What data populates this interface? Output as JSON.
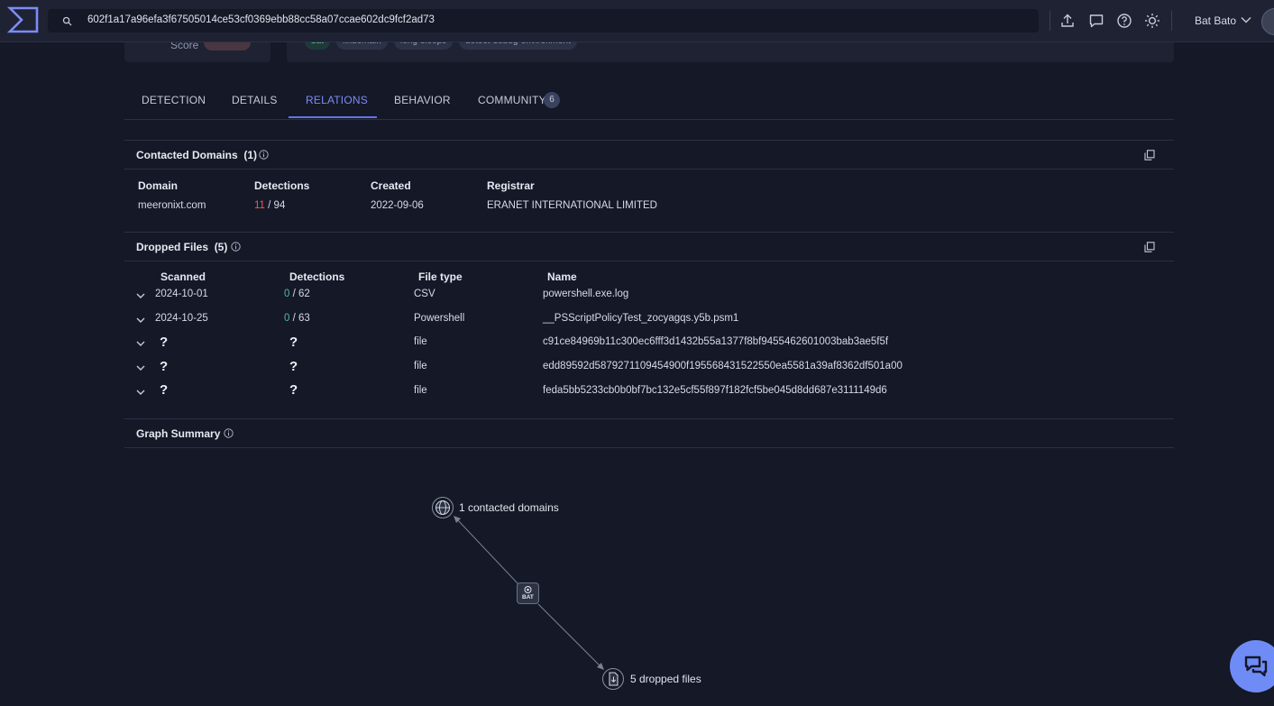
{
  "topbar": {
    "search_value": "602f1a17a96efa3f67505014ce53cf0369ebb88cc58a07ccae602dc9fcf2ad73",
    "user_name": "Bat Bato",
    "icons": [
      "upload-icon",
      "chat-icon",
      "help-icon",
      "theme-icon"
    ]
  },
  "header": {
    "score_label": "Score",
    "tags": [
      "bat",
      "fixdomain",
      "long-sleeps",
      "detect-debug-environment"
    ]
  },
  "tabs": [
    {
      "label": "DETECTION",
      "active": false
    },
    {
      "label": "DETAILS",
      "active": false
    },
    {
      "label": "RELATIONS",
      "active": true
    },
    {
      "label": "BEHAVIOR",
      "active": false
    },
    {
      "label": "COMMUNITY",
      "active": false,
      "badge": "6"
    }
  ],
  "contacted_domains": {
    "title": "Contacted Domains",
    "count": "(1)",
    "columns": [
      "Domain",
      "Detections",
      "Created",
      "Registrar"
    ],
    "rows": [
      {
        "domain": "meeronixt.com",
        "detections": "11",
        "total": "/ 94",
        "created": "2022-09-06",
        "registrar": "ERANET INTERNATIONAL LIMITED"
      }
    ]
  },
  "dropped_files": {
    "title": "Dropped Files",
    "count": "(5)",
    "columns": [
      "Scanned",
      "Detections",
      "File type",
      "Name"
    ],
    "rows": [
      {
        "scanned": "2024-10-01",
        "detections": "0",
        "total": "/ 62",
        "type": "CSV",
        "name": "powershell.exe.log"
      },
      {
        "scanned": "2024-10-25",
        "detections": "0",
        "total": "/ 63",
        "type": "Powershell",
        "name": "__PSScriptPolicyTest_zocyagqs.y5b.psm1"
      },
      {
        "scanned": "?",
        "detections": "?",
        "total": "",
        "type": "file",
        "name": "c91ce84969b11c300ec6fff3d1432b55a1377f8bf9455462601003bab3ae5f5f"
      },
      {
        "scanned": "?",
        "detections": "?",
        "total": "",
        "type": "file",
        "name": "edd89592d5879271109454900f195568431522550ea5581a39af8362df501a00"
      },
      {
        "scanned": "?",
        "detections": "?",
        "total": "",
        "type": "file",
        "name": "feda5bb5233cb0b0bf7bc132e5cf55f897f182fcf5be045d8dd687e3111149d6"
      }
    ]
  },
  "graph_summary": {
    "title": "Graph Summary",
    "center_node_label": "BAT",
    "domains_label": "1 contacted domains",
    "files_label": "5 dropped files"
  },
  "colors": {
    "accent": "#6673e8",
    "detection_red": "#ee5a5a",
    "detection_clean": "#4fb7a3",
    "background": "#151826"
  }
}
